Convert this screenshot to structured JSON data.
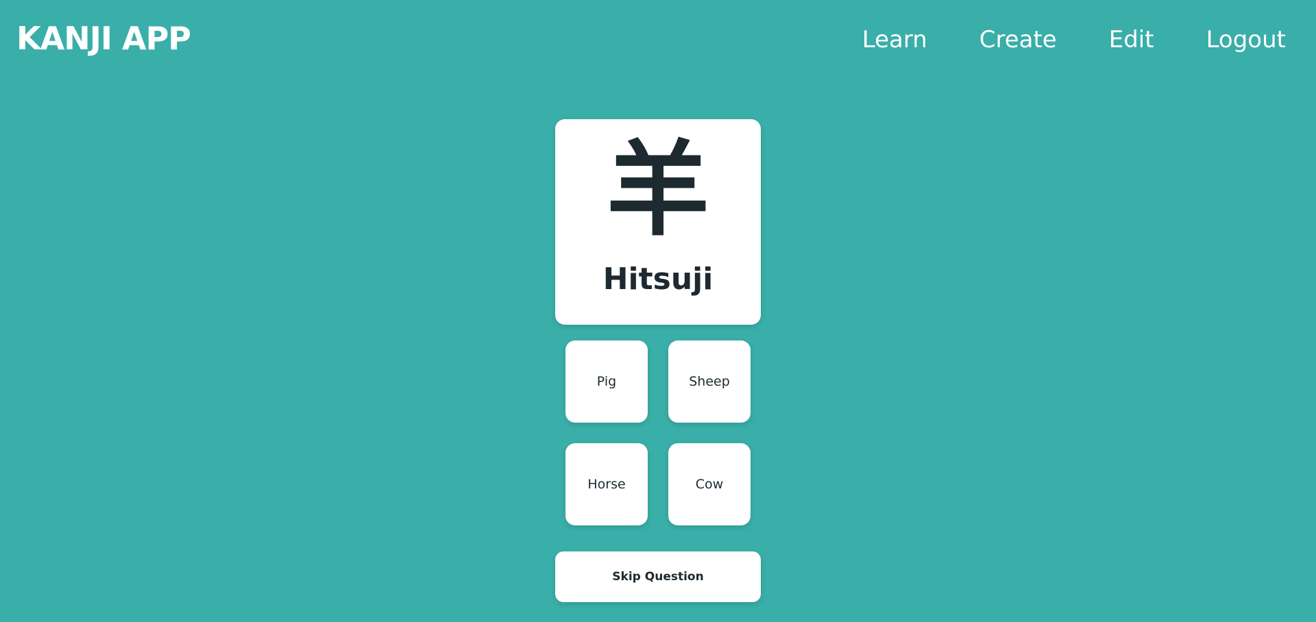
{
  "header": {
    "logo": "KANJI APP",
    "nav": {
      "learn": "Learn",
      "create": "Create",
      "edit": "Edit",
      "logout": "Logout"
    }
  },
  "card": {
    "kanji": "羊",
    "reading": "Hitsuji"
  },
  "options": [
    "Pig",
    "Sheep",
    "Horse",
    "Cow"
  ],
  "skip_label": "Skip Question",
  "colors": {
    "background": "#3aaea8",
    "card": "#ffffff",
    "text_dark": "#1d2a30",
    "header_text": "#ffffff"
  }
}
